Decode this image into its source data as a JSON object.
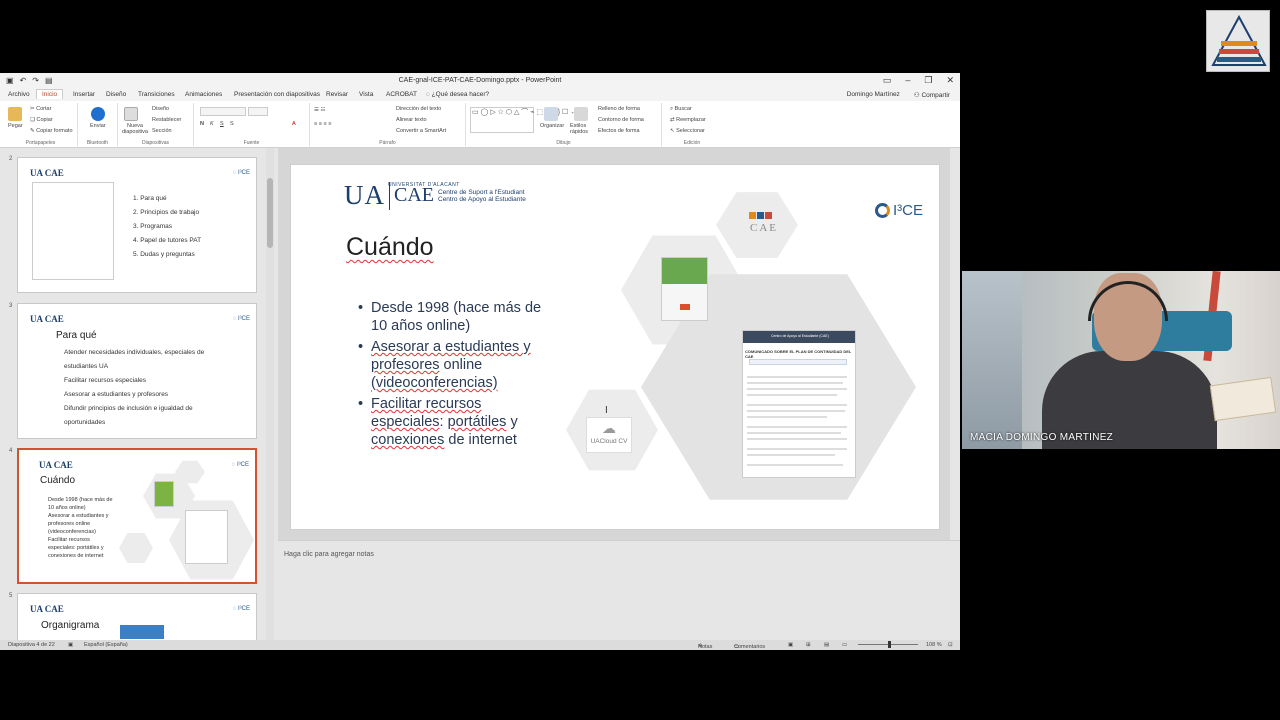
{
  "window": {
    "title": "CAE-gnal-ICE-PAT-CAE-Domingo.pptx - PowerPoint",
    "user": "Domingo Martínez",
    "share": "Compartir"
  },
  "tabs": [
    "Archivo",
    "Inicio",
    "Insertar",
    "Diseño",
    "Transiciones",
    "Animaciones",
    "Presentación con diapositivas",
    "Revisar",
    "Vista",
    "ACROBAT",
    "¿Qué desea hacer?"
  ],
  "ribbon": {
    "portapapeles": {
      "label": "Portapapeles",
      "pegar": "Pegar",
      "cortar": "Cortar",
      "copiar": "Copiar",
      "copiar_formato": "Copiar formato"
    },
    "bluetooth": {
      "label": "Bluetooth",
      "enviar": "Enviar"
    },
    "diapositivas": {
      "label": "Diapositivas",
      "nueva": "Nueva diapositiva",
      "diseno": "Diseño",
      "restablecer": "Restablecer",
      "seccion": "Sección"
    },
    "fuente": {
      "label": "Fuente"
    },
    "parrafo": {
      "label": "Párrafo",
      "direccion": "Dirección del texto",
      "alinear": "Alinear texto",
      "smartart": "Convertir a SmartArt"
    },
    "dibujo": {
      "label": "Dibujo",
      "organizar": "Organizar",
      "estilos": "Estilos rápidos",
      "relleno": "Relleno de forma",
      "contorno": "Contorno de forma",
      "efectos": "Efectos de forma"
    },
    "edicion": {
      "label": "Edición",
      "buscar": "Buscar",
      "reemplazar": "Reemplazar",
      "seleccionar": "Seleccionar"
    }
  },
  "thumbnails": [
    {
      "num": "2",
      "items": [
        "1.  Para qué",
        "2.  Principios de trabajo",
        "3.  Programas",
        "4.  Papel de tutores PAT",
        "5.  Dudas y preguntas"
      ]
    },
    {
      "num": "3",
      "title": "Para qué",
      "items": [
        "Atender necesidades individuales, especiales de",
        "estudiantes UA",
        "Facilitar recursos especiales",
        "Asesorar a estudiantes y profesores",
        "Difundir principios de inclusión e igualdad de",
        "oportunidades"
      ]
    },
    {
      "num": "4",
      "title": "Cuándo",
      "items": [
        "Desde 1998 (hace más de",
        "10 años online)",
        "Asesorar a estudiantes y",
        "profesores online",
        "(videoconferencias)",
        "Facilitar recursos",
        "especiales: portátiles y",
        "conexiones de internet"
      ]
    },
    {
      "num": "5",
      "title": "Organigrama"
    }
  ],
  "slide": {
    "univ": "UNIVERSITAT D'ALACANT",
    "ua": "UA",
    "cae": "CAE",
    "cae_line1": "Centre de Suport a l'Estudiant",
    "cae_line2": "Centro de Apoyo al Estudiante",
    "i3ce": "I³CE",
    "title": "Cuándo",
    "bullet1": "Desde 1998 (hace más de 10 años online)",
    "bullet2_a": "Asesorar a estudiantes y",
    "bullet2_b": "profesores",
    "bullet2_c": " online",
    "bullet2_d": "(videoconferencias)",
    "bullet3_a": "Facilitar recursos",
    "bullet3_b": "especiales",
    "bullet3_c": ": ",
    "bullet3_d": "portátiles",
    "bullet3_e": " y",
    "bullet3_f": "conexiones",
    "bullet3_g": " de internet",
    "cloud_label": "UACloud CV",
    "doc_heading": "Centro de Apoyo al Estudiante (CAE)",
    "doc_sub": "COMUNICADO SOBRE EL PLAN DE CONTINUIDAD DEL CAE",
    "cae_mini": "CAE"
  },
  "notes_placeholder": "Haga clic para agregar notas",
  "status": {
    "slide_count": "Diapositiva 4 de 22",
    "language": "Español (España)",
    "notas": "Notas",
    "comentarios": "Comentarios",
    "zoom": "108 %"
  },
  "webcam": {
    "name": "MACIA DOMINGO MARTINEZ"
  },
  "colors": {
    "accent": "#d35230",
    "ua_blue": "#1c3f6e"
  }
}
